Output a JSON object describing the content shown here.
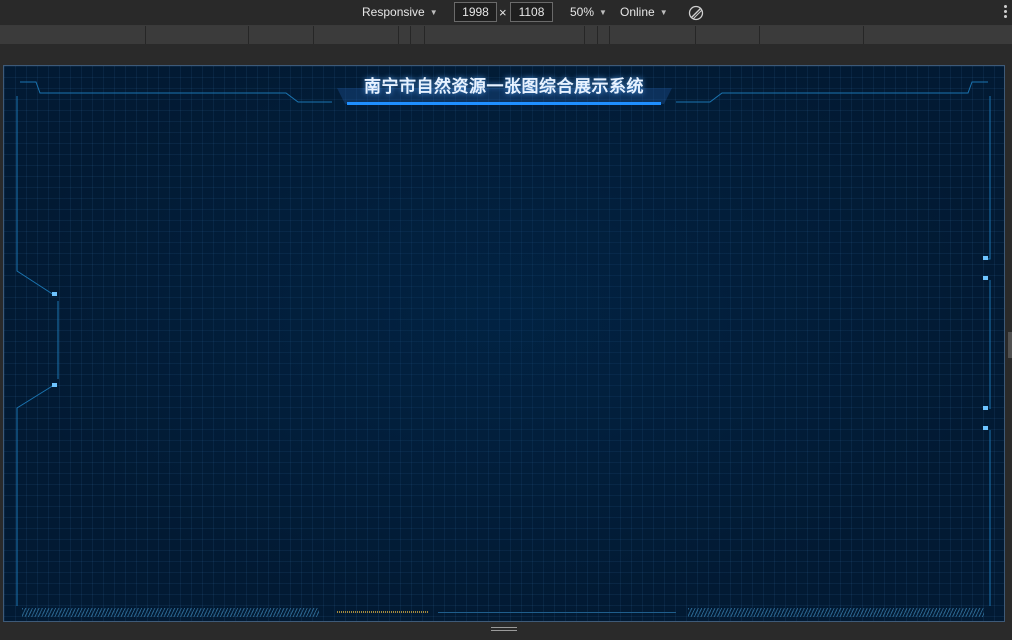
{
  "devtools": {
    "device": "Responsive",
    "width": "1998",
    "height": "1108",
    "times": "×",
    "zoom": "50%",
    "network": "Online",
    "icons": {
      "rotate": "rotate-icon",
      "more": "more-vertical-icon",
      "caret": "caret-down-icon"
    }
  },
  "page": {
    "title": "南宁市自然资源一张图综合展示系统"
  },
  "colors": {
    "background": "#021a33",
    "frame_line": "#1b74b0",
    "title_bar": "#1f8fff",
    "accent_text": "#e7f2ff"
  }
}
